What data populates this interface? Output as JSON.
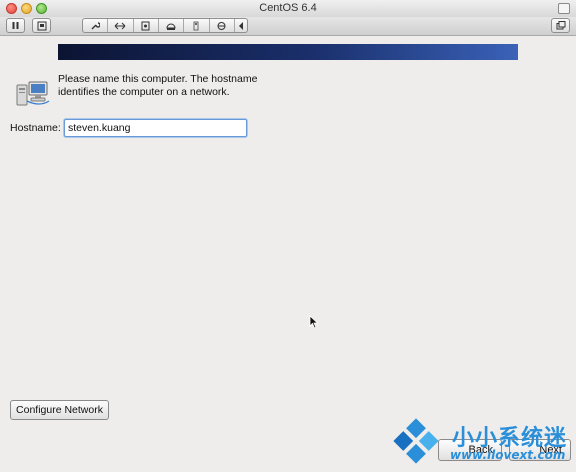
{
  "window": {
    "title": "CentOS 6.4"
  },
  "toolbar": {
    "icons": [
      "pause-icon",
      "snapshot-icon",
      "wrench-icon",
      "network-arrows-icon",
      "disk-icon",
      "cdrom-icon",
      "usb-icon",
      "share-icon",
      "chevron-left-icon",
      "window-icon"
    ]
  },
  "installer": {
    "instructions": "Please name this computer.  The hostname identifies the computer on a network.",
    "hostname_label": "Hostname:",
    "hostname_value": "steven.kuang",
    "configure_network_label": "Configure Network",
    "back_label": "Back",
    "next_label": "Next"
  },
  "watermark": {
    "title": "小小系统迷",
    "url": "www.ilovext.com"
  },
  "colors": {
    "banner_dark": "#0c1432",
    "banner_light": "#3a62b8",
    "watermark_blue": "#2a8fd8",
    "input_focus": "#6b9ad6"
  }
}
